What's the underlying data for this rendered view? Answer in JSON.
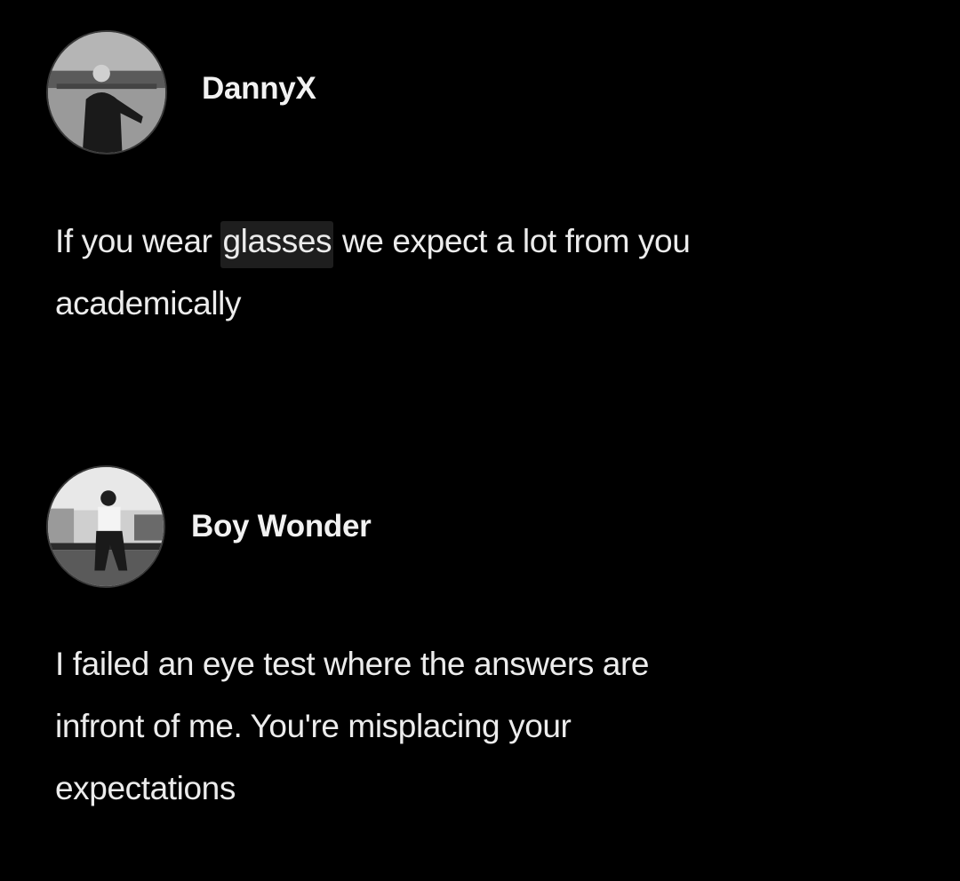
{
  "posts": [
    {
      "username": "DannyX",
      "avatar_icon": "profile-photo-icon",
      "text_before": "If you wear ",
      "highlight": "glasses",
      "text_after": " we expect a lot from you",
      "line2": "academically"
    },
    {
      "username": "Boy Wonder",
      "avatar_icon": "profile-photo-icon",
      "line1": "I failed an eye test where the answers are",
      "line2": "infront of me. You're misplacing your",
      "line3": "expectations"
    }
  ],
  "colors": {
    "background": "#000000",
    "text": "#ececec",
    "highlight_bg": "#1e1e1e"
  }
}
